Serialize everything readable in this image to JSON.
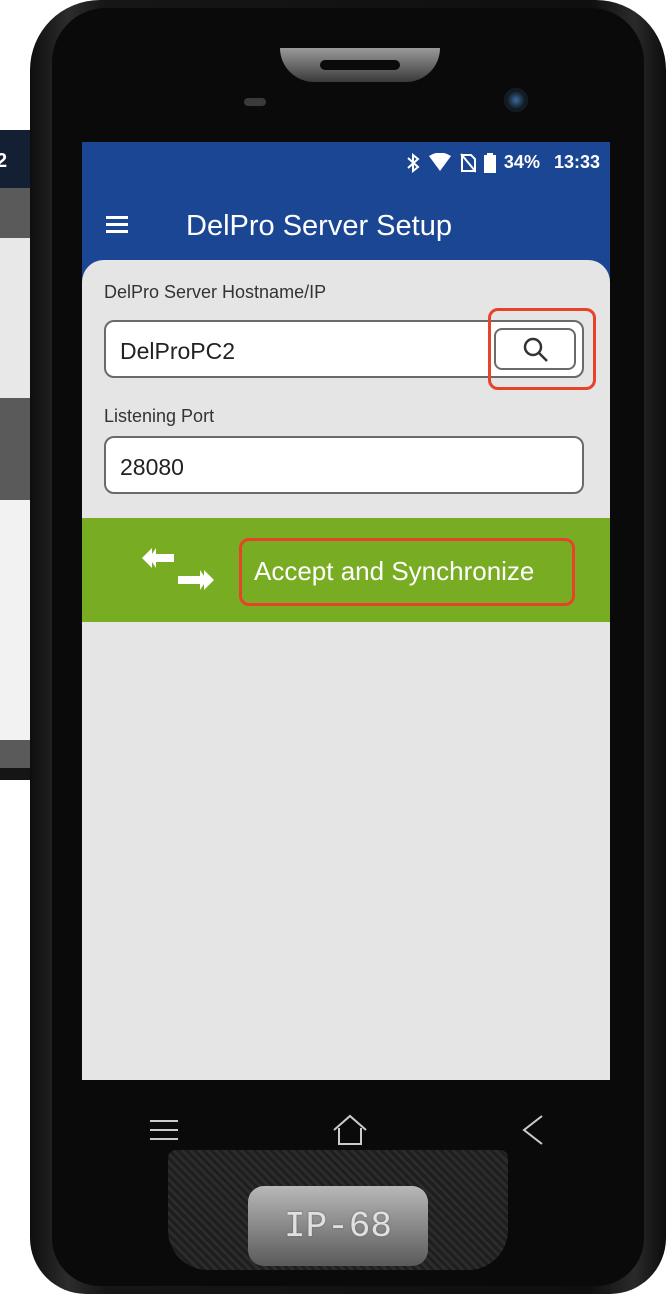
{
  "background_phone": {
    "fragment": "2"
  },
  "status_bar": {
    "battery_percent": "34%",
    "time": "13:33",
    "icons": [
      "bluetooth-icon",
      "wifi-icon",
      "no-sim-icon",
      "battery-icon"
    ]
  },
  "app_bar": {
    "title": "DelPro Server Setup",
    "menu_icon": "hamburger-menu-icon"
  },
  "form": {
    "hostname_label": "DelPro Server Hostname/IP",
    "hostname_value": "DelProPC2",
    "search_icon": "search-icon",
    "port_label": "Listening Port",
    "port_value": "28080"
  },
  "sync": {
    "label": "Accept and Synchronize",
    "icon": "sync-arrows-icon"
  },
  "nav": {
    "menu_icon": "nav-menu-icon",
    "home_icon": "nav-home-icon",
    "back_icon": "nav-back-icon"
  },
  "device": {
    "rating": "IP-68"
  },
  "colors": {
    "app_bar": "#1a4693",
    "sync_bar": "#78ac23",
    "highlight": "#e8432a",
    "screen_bg": "#e5e5e5"
  }
}
